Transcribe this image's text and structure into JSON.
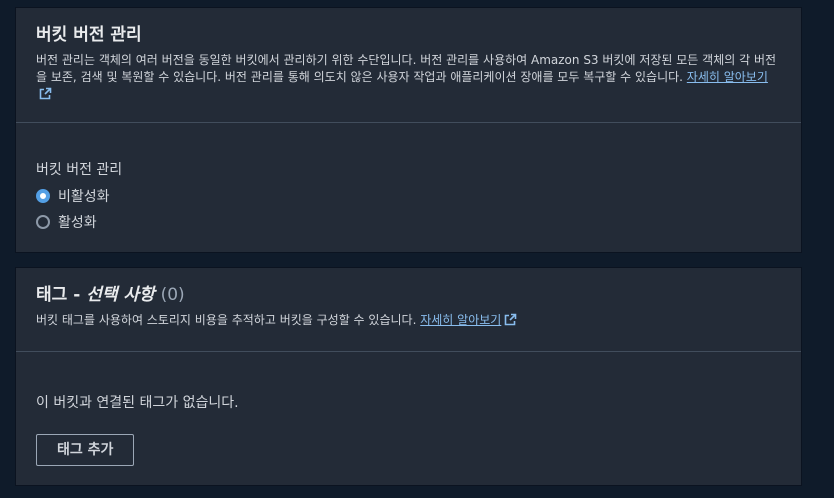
{
  "versioning": {
    "title": "버킷 버전 관리",
    "description": "버전 관리는 객체의 여러 버전을 동일한 버킷에서 관리하기 위한 수단입니다. 버전 관리를 사용하여 Amazon S3 버킷에 저장된 모든 객체의 각 버전을 보존, 검색 및 복원할 수 있습니다. 버전 관리를 통해 의도치 않은 사용자 작업과 애플리케이션 장애를 모두 복구할 수 있습니다.",
    "learn_more": "자세히 알아보기",
    "field_label": "버킷 버전 관리",
    "options": [
      {
        "label": "비활성화",
        "selected": true
      },
      {
        "label": "활성화",
        "selected": false
      }
    ]
  },
  "tags": {
    "title_prefix": "태그 - ",
    "title_optional": "선택 사항",
    "count": "(0)",
    "description": "버킷 태그를 사용하여 스토리지 비용을 추적하고 버킷을 구성할 수 있습니다.",
    "learn_more": "자세히 알아보기",
    "empty_text": "이 버킷과 연결된 태그가 없습니다.",
    "add_button": "태그 추가"
  },
  "colors": {
    "page_bg": "#0f1b2a",
    "panel_bg": "#232b37",
    "link": "#89bdee",
    "radio_selected": "#539fe5"
  }
}
